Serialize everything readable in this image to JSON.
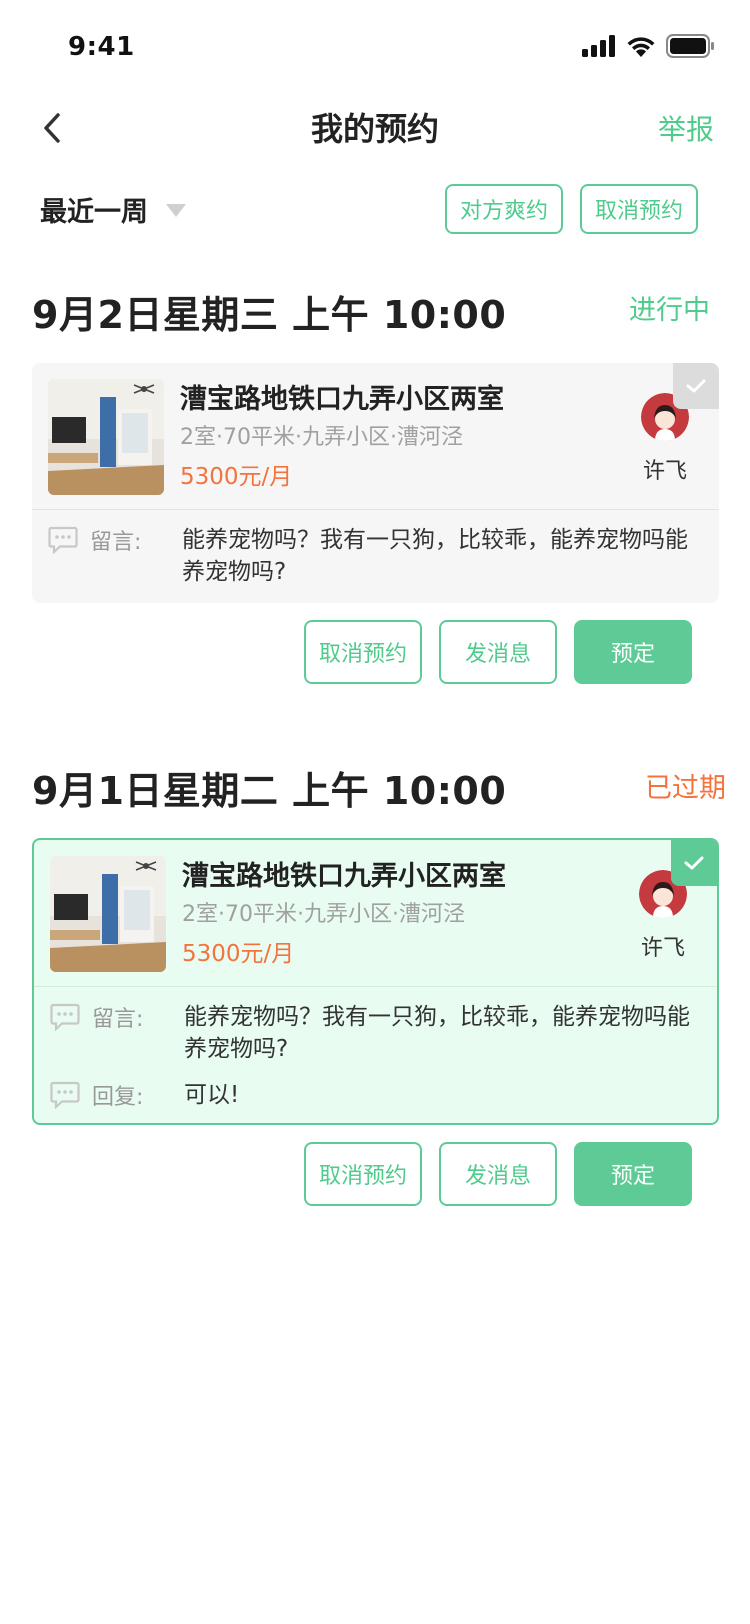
{
  "status_bar": {
    "time": "9:41"
  },
  "nav": {
    "title": "我的预约",
    "report": "举报"
  },
  "filter": {
    "label": "最近一周",
    "btn_no_show": "对方爽约",
    "btn_cancel": "取消预约"
  },
  "colors": {
    "accent": "#5ecb96",
    "accent_text": "#4fcb8c",
    "price": "#f4733c",
    "expired": "#f4733c"
  },
  "appointments": [
    {
      "date": "9月2日星期三 上午 10:00",
      "status": "进行中",
      "house_title": "漕宝路地铁口九弄小区两室",
      "house_info": "2室·70平米·九弄小区·漕河泾",
      "price": "5300元/月",
      "agent": "许飞",
      "message_label": "留言:",
      "message": "能养宠物吗？我有一只狗，比较乖，能养宠物吗能养宠物吗?",
      "buttons": {
        "cancel": "取消预约",
        "message": "发消息",
        "book": "预定"
      }
    },
    {
      "date": "9月1日星期二 上午 10:00",
      "status": "已过期",
      "house_title": "漕宝路地铁口九弄小区两室",
      "house_info": "2室·70平米·九弄小区·漕河泾",
      "price": "5300元/月",
      "agent": "许飞",
      "message_label": "留言:",
      "message": "能养宠物吗？我有一只狗，比较乖，能养宠物吗能养宠物吗?",
      "reply_label": "回复:",
      "reply": "可以!",
      "buttons": {
        "cancel": "取消预约",
        "message": "发消息",
        "book": "预定"
      }
    }
  ]
}
